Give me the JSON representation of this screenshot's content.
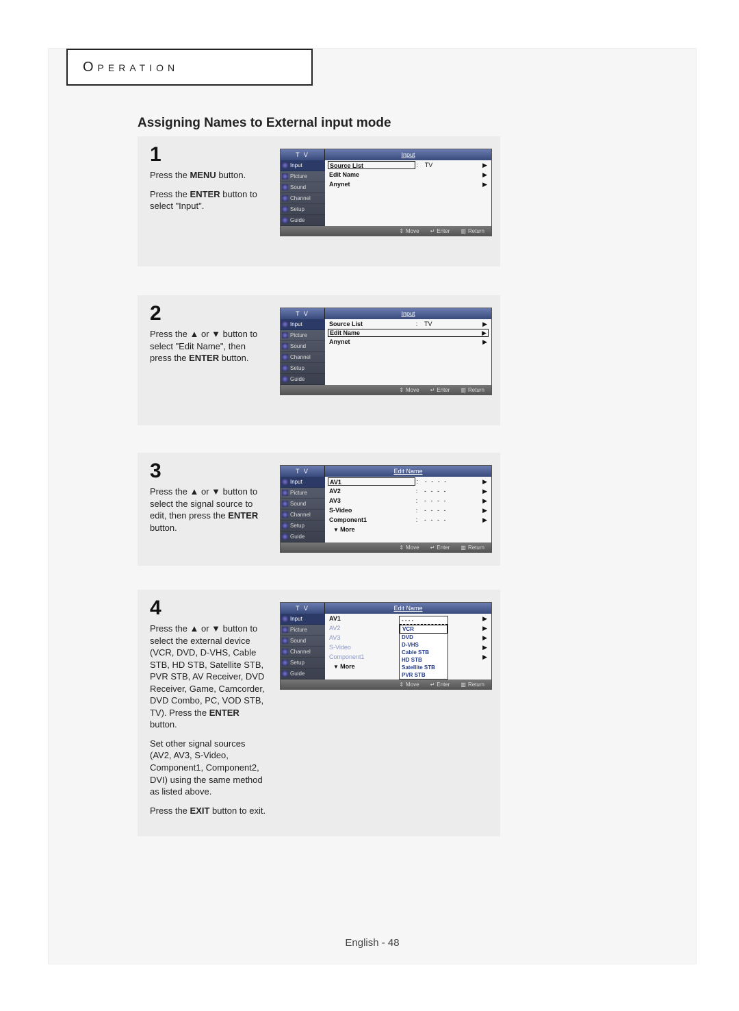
{
  "header": "Operation",
  "title": "Assigning Names to External input mode",
  "footer": "English - 48",
  "osd_labels": {
    "tv": "T V",
    "input_hdr": "Input",
    "editname_hdr": "Edit Name",
    "move": "Move",
    "enter": "Enter",
    "return": "Return",
    "more": "More"
  },
  "side_items": [
    "Input",
    "Picture",
    "Sound",
    "Channel",
    "Setup",
    "Guide"
  ],
  "steps": [
    {
      "num": "1",
      "paras": [
        "Press the <b>MENU</b> button.",
        "Press the <b>ENTER</b> button to select \"Input\"."
      ],
      "rows": [
        {
          "label": "Source List",
          "colon": ":",
          "val": "TV",
          "sel": true
        },
        {
          "label": "Edit Name"
        },
        {
          "label": "Anynet"
        }
      ],
      "header_right": "input"
    },
    {
      "num": "2",
      "paras": [
        "Press the ▲ or ▼ button to select \"Edit Name\", then press the <b>ENTER</b> button."
      ],
      "rows": [
        {
          "label": "Source List",
          "colon": ":",
          "val": "TV"
        },
        {
          "label": "Edit Name",
          "selFull": true
        },
        {
          "label": "Anynet"
        }
      ],
      "header_right": "input"
    },
    {
      "num": "3",
      "paras": [
        "Press the ▲ or ▼ button to select the signal source to edit, then press the <b>ENTER</b> button."
      ],
      "rows": [
        {
          "label": "AV1",
          "colon": ":",
          "val": "- - - -",
          "sel": true
        },
        {
          "label": "AV2",
          "colon": ":",
          "val": "- - - -"
        },
        {
          "label": "AV3",
          "colon": ":",
          "val": "- - - -"
        },
        {
          "label": "S-Video",
          "colon": ":",
          "val": "- - - -"
        },
        {
          "label": "Component1",
          "colon": ":",
          "val": "- - - -"
        }
      ],
      "more": true,
      "header_right": "editname"
    },
    {
      "num": "4",
      "paras": [
        "Press the ▲ or ▼ button to select the external device (VCR, DVD, D-VHS, Cable STB, HD STB, Satellite STB, PVR STB, AV Receiver, DVD Receiver, Game, Camcorder, DVD Combo, PC, VOD STB, TV). Press the <b>ENTER</b> button.",
        "Set other signal sources (AV2,  AV3, S-Video, Component1, Component2, DVI) using the same method as listed above.",
        "Press the <b>EXIT</b> button to exit."
      ],
      "rows": [
        {
          "label": "AV1",
          "colon": ":",
          "first": true
        },
        {
          "label": "AV2",
          "colon": ":"
        },
        {
          "label": "AV3",
          "colon": ":"
        },
        {
          "label": "S-Video",
          "colon": ":"
        },
        {
          "label": "Component1",
          "colon": ":"
        }
      ],
      "more": true,
      "header_right": "editname",
      "dropdown": [
        "- - - -",
        "VCR",
        "DVD",
        "D-VHS",
        "Cable STB",
        "HD STB",
        "Satellite STB",
        "PVR STB"
      ]
    }
  ]
}
